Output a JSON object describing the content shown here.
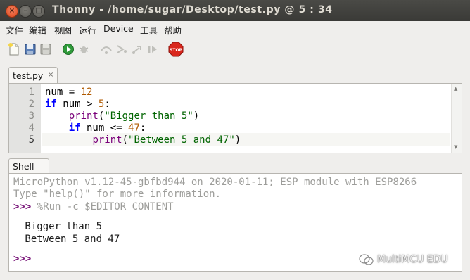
{
  "window": {
    "title": "Thonny  -  /home/sugar/Desktop/test.py  @  5 : 34",
    "close_glyph": "×",
    "minimize_glyph": "–",
    "maximize_glyph": "□"
  },
  "menu": [
    "文件",
    "编辑",
    "视图",
    "运行",
    "Device",
    "工具",
    "帮助"
  ],
  "toolbar": {
    "icons": [
      "new-file-icon",
      "open-file-icon",
      "save-file-icon",
      "run-icon",
      "debug-icon",
      "step-over-icon",
      "step-into-icon",
      "step-out-icon",
      "resume-icon",
      "stop-icon"
    ],
    "stop_label": "STOP"
  },
  "editor": {
    "tab_label": "test.py",
    "tab_close": "×",
    "line_numbers": [
      "1",
      "2",
      "3",
      "4",
      "5"
    ]
  },
  "shell": {
    "tab_label": "Shell",
    "banner_1": "MicroPython v1.12-45-gbfbd944 on 2020-01-11; ESP module with ESP8266",
    "banner_2": "Type \"help()\" for more information.",
    "prompt": ">>>",
    "command": " %Run -c $EDITOR_CONTENT",
    "output_1": " Bigger than 5",
    "output_2": " Between 5 and 47",
    "final_prompt": ">>>"
  },
  "watermark": "MultiMCU EDU"
}
